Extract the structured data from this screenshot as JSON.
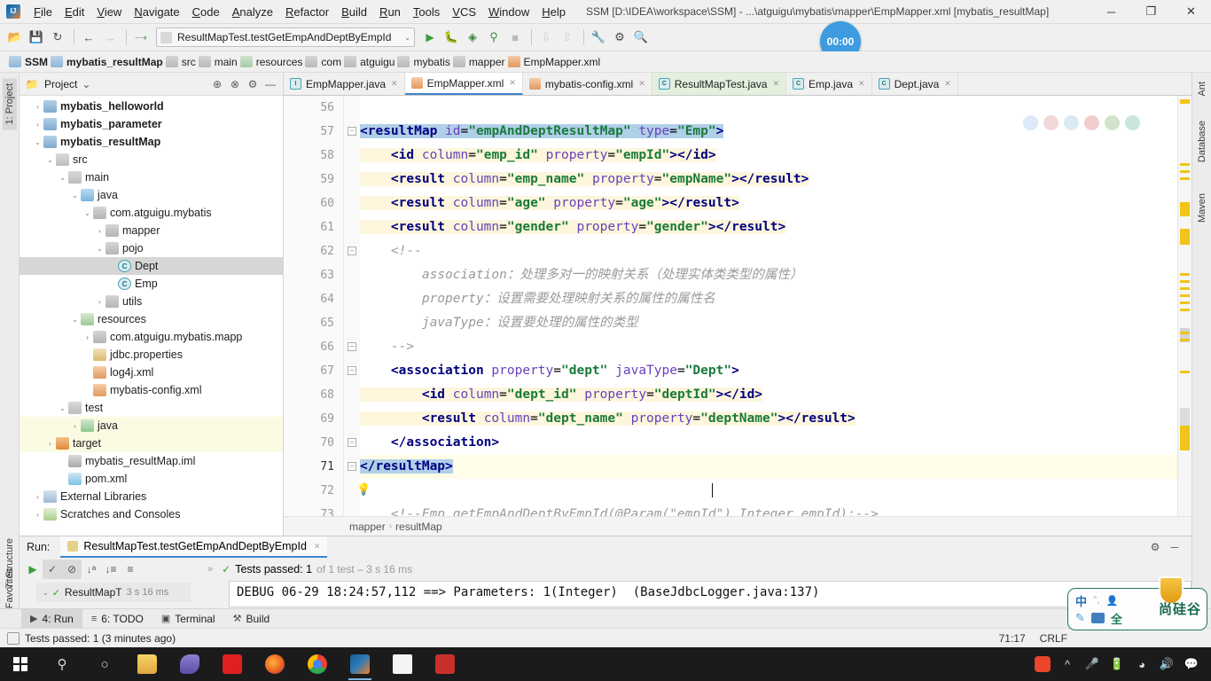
{
  "titlebar": {
    "menus": [
      "File",
      "Edit",
      "View",
      "Navigate",
      "Code",
      "Analyze",
      "Refactor",
      "Build",
      "Run",
      "Tools",
      "VCS",
      "Window",
      "Help"
    ],
    "window_title": "SSM [D:\\IDEA\\workspace\\SSM] - ...\\atguigu\\mybatis\\mapper\\EmpMapper.xml [mybatis_resultMap]",
    "minimize": "─",
    "maximize": "❐",
    "close": "✕"
  },
  "toolbar": {
    "run_config": "ResultMapTest.testGetEmpAndDeptByEmpId",
    "dropdown_arrow": "⌄",
    "timer_badge": "00:00",
    "icons": [
      "open-icon",
      "save-icon",
      "sync-icon",
      "back-icon",
      "forward-icon",
      "build-icon",
      "run-icon",
      "debug-icon",
      "coverage-icon",
      "profile-icon",
      "stop-icon",
      "update-icon",
      "commit-icon",
      "settings-icon",
      "structure-icon",
      "search-icon"
    ]
  },
  "navbar": {
    "crumbs": [
      {
        "label": "SSM",
        "icon": "module-icon",
        "bold": true
      },
      {
        "label": "mybatis_resultMap",
        "icon": "module-icon",
        "bold": true
      },
      {
        "label": "src",
        "icon": "folder-icon",
        "bold": false
      },
      {
        "label": "main",
        "icon": "folder-icon",
        "bold": false
      },
      {
        "label": "resources",
        "icon": "resources-folder-icon",
        "bold": false
      },
      {
        "label": "com",
        "icon": "folder-icon",
        "bold": false
      },
      {
        "label": "atguigu",
        "icon": "folder-icon",
        "bold": false
      },
      {
        "label": "mybatis",
        "icon": "folder-icon",
        "bold": false
      },
      {
        "label": "mapper",
        "icon": "folder-icon",
        "bold": false
      },
      {
        "label": "EmpMapper.xml",
        "icon": "xml-file-icon",
        "bold": false
      }
    ]
  },
  "left_strip": {
    "top_tab": "1: Project",
    "bottom_tabs": [
      "2: Favorites",
      "7: Structure"
    ]
  },
  "right_strip": {
    "tabs": [
      "Ant",
      "Database",
      "Maven"
    ]
  },
  "project_panel": {
    "title": "Project",
    "dropdown": "⌄",
    "header_icons": [
      "collapse-all-icon",
      "expand-icon",
      "settings-gear-icon",
      "hide-icon"
    ],
    "tree": [
      {
        "label": "mybatis_helloworld",
        "depth": 1,
        "arrow": "›",
        "icon": "i-module",
        "bold": true,
        "state": "normal"
      },
      {
        "label": "mybatis_parameter",
        "depth": 1,
        "arrow": "›",
        "icon": "i-module",
        "bold": true,
        "state": "normal"
      },
      {
        "label": "mybatis_resultMap",
        "depth": 1,
        "arrow": "⌄",
        "icon": "i-module",
        "bold": true,
        "state": "normal"
      },
      {
        "label": "src",
        "depth": 2,
        "arrow": "⌄",
        "icon": "i-folder",
        "bold": false,
        "state": "normal"
      },
      {
        "label": "main",
        "depth": 3,
        "arrow": "⌄",
        "icon": "i-folder",
        "bold": false,
        "state": "normal"
      },
      {
        "label": "java",
        "depth": 4,
        "arrow": "⌄",
        "icon": "i-src",
        "bold": false,
        "state": "normal"
      },
      {
        "label": "com.atguigu.mybatis",
        "depth": 5,
        "arrow": "⌄",
        "icon": "i-pkg",
        "bold": false,
        "state": "normal"
      },
      {
        "label": "mapper",
        "depth": 6,
        "arrow": "›",
        "icon": "i-pkg",
        "bold": false,
        "state": "normal"
      },
      {
        "label": "pojo",
        "depth": 6,
        "arrow": "⌄",
        "icon": "i-pkg",
        "bold": false,
        "state": "normal"
      },
      {
        "label": "Dept",
        "depth": 7,
        "arrow": "",
        "icon": "i-class",
        "bold": false,
        "state": "selected"
      },
      {
        "label": "Emp",
        "depth": 7,
        "arrow": "",
        "icon": "i-class",
        "bold": false,
        "state": "normal"
      },
      {
        "label": "utils",
        "depth": 6,
        "arrow": "›",
        "icon": "i-pkg",
        "bold": false,
        "state": "normal"
      },
      {
        "label": "resources",
        "depth": 4,
        "arrow": "⌄",
        "icon": "i-res",
        "bold": false,
        "state": "normal"
      },
      {
        "label": "com.atguigu.mybatis.mapp",
        "depth": 5,
        "arrow": "›",
        "icon": "i-pkg",
        "bold": false,
        "state": "normal"
      },
      {
        "label": "jdbc.properties",
        "depth": 5,
        "arrow": "",
        "icon": "i-prop",
        "bold": false,
        "state": "normal"
      },
      {
        "label": "log4j.xml",
        "depth": 5,
        "arrow": "",
        "icon": "i-xml",
        "bold": false,
        "state": "normal"
      },
      {
        "label": "mybatis-config.xml",
        "depth": 5,
        "arrow": "",
        "icon": "i-xml",
        "bold": false,
        "state": "normal"
      },
      {
        "label": "test",
        "depth": 3,
        "arrow": "⌄",
        "icon": "i-folder",
        "bold": false,
        "state": "normal"
      },
      {
        "label": "java",
        "depth": 4,
        "arrow": "›",
        "icon": "i-test",
        "bold": false,
        "state": "highlight"
      },
      {
        "label": "target",
        "depth": 2,
        "arrow": "›",
        "icon": "i-target",
        "bold": false,
        "state": "highlight"
      },
      {
        "label": "mybatis_resultMap.iml",
        "depth": 3,
        "arrow": "",
        "icon": "i-iml",
        "bold": false,
        "state": "normal"
      },
      {
        "label": "pom.xml",
        "depth": 3,
        "arrow": "",
        "icon": "i-pom",
        "bold": false,
        "state": "normal"
      },
      {
        "label": "External Libraries",
        "depth": 1,
        "arrow": "›",
        "icon": "i-lib",
        "bold": false,
        "state": "normal"
      },
      {
        "label": "Scratches and Consoles",
        "depth": 1,
        "arrow": "›",
        "icon": "i-scratch",
        "bold": false,
        "state": "normal"
      }
    ]
  },
  "editor": {
    "tabs": [
      {
        "label": "EmpMapper.java",
        "icon": "interface-icon",
        "active": false,
        "tinted": false
      },
      {
        "label": "EmpMapper.xml",
        "icon": "xml-file-icon",
        "active": true,
        "tinted": false
      },
      {
        "label": "mybatis-config.xml",
        "icon": "xml-file-icon",
        "active": false,
        "tinted": false
      },
      {
        "label": "ResultMapTest.java",
        "icon": "class-icon",
        "active": false,
        "tinted": true
      },
      {
        "label": "Emp.java",
        "icon": "class-icon",
        "active": false,
        "tinted": false
      },
      {
        "label": "Dept.java",
        "icon": "class-icon",
        "active": false,
        "tinted": false
      }
    ],
    "lines": [
      {
        "num": "56",
        "text": ""
      },
      {
        "num": "57",
        "text": "<resultMap id=\"empAndDeptResultMap\" type=\"Emp\">"
      },
      {
        "num": "58",
        "text": "    <id column=\"emp_id\" property=\"empId\"></id>"
      },
      {
        "num": "59",
        "text": "    <result column=\"emp_name\" property=\"empName\"></result>"
      },
      {
        "num": "60",
        "text": "    <result column=\"age\" property=\"age\"></result>"
      },
      {
        "num": "61",
        "text": "    <result column=\"gender\" property=\"gender\"></result>"
      },
      {
        "num": "62",
        "text": "    <!--"
      },
      {
        "num": "63",
        "text": "        association：处理多对一的映射关系（处理实体类类型的属性）"
      },
      {
        "num": "64",
        "text": "        property：设置需要处理映射关系的属性的属性名"
      },
      {
        "num": "65",
        "text": "        javaType：设置要处理的属性的类型"
      },
      {
        "num": "66",
        "text": "    -->"
      },
      {
        "num": "67",
        "text": "    <association property=\"dept\" javaType=\"Dept\">"
      },
      {
        "num": "68",
        "text": "        <id column=\"dept_id\" property=\"deptId\"></id>"
      },
      {
        "num": "69",
        "text": "        <result column=\"dept_name\" property=\"deptName\"></result>"
      },
      {
        "num": "70",
        "text": "    </association>"
      },
      {
        "num": "71",
        "text": "</resultMap>"
      },
      {
        "num": "72",
        "text": ""
      },
      {
        "num": "73",
        "text": "    <!--Emp getEmpAndDeptByEmpId(@Param(\"empId\") Integer empId);-->"
      }
    ],
    "breadcrumb": [
      "mapper",
      "resultMap"
    ],
    "breadcrumb_sep": "›"
  },
  "run_panel": {
    "label": "Run:",
    "tab_title": "ResultMapTest.testGetEmpAndDeptByEmpId",
    "close": "✕",
    "gear": "⚙",
    "minimize": "─",
    "status_check": "✓",
    "status_main": "Tests passed: 1",
    "status_dim": "of 1 test – 3 s 16 ms",
    "tree_node": "ResultMapT",
    "tree_node_time": "3 s 16 ms",
    "console": "DEBUG 06-29 18:24:57,112 ==> Parameters: 1(Integer)  (BaseJdbcLogger.java:137)",
    "tool_icons": [
      "rerun-icon",
      "filter-passed-icon",
      "ignore-icon",
      "sort-alpha-icon",
      "sort-duration-icon",
      "expand-icon",
      "more-icon"
    ]
  },
  "bottom_bar": {
    "items": [
      {
        "label": "4: Run",
        "icon": "run-icon",
        "selected": true
      },
      {
        "label": "6: TODO",
        "icon": "todo-icon",
        "selected": false
      },
      {
        "label": "Terminal",
        "icon": "terminal-icon",
        "selected": false
      },
      {
        "label": "Build",
        "icon": "build-hammer-icon",
        "selected": false
      }
    ]
  },
  "status_bar": {
    "message": "Tests passed: 1 (3 minutes ago)",
    "caret_position": "71:17",
    "line_separator": "CRLF"
  },
  "ime": {
    "mode": "中",
    "punct": "°,",
    "full_width": "全",
    "brand": "尚硅谷"
  },
  "taskbar": {
    "apps": [
      "start-icon",
      "search-icon",
      "cortana-icon",
      "explorer-icon",
      "navicat-icon",
      "baidu-icon",
      "firefox-icon",
      "chrome-icon",
      "intellij-icon",
      "notepad-icon",
      "wps-icon"
    ],
    "tray": [
      "sogou-icon",
      "chevron-up-icon",
      "mic-icon",
      "battery-icon",
      "wifi-icon",
      "volume-icon",
      "notification-icon"
    ]
  },
  "colors": {
    "accent": "#3e86d0",
    "tag": "#000080",
    "attr": "#6a3fbd",
    "value": "#1a7a3c",
    "comment": "#9a9a9a",
    "highlight": "#fdf6dd",
    "selection": "#b0cfe8"
  }
}
